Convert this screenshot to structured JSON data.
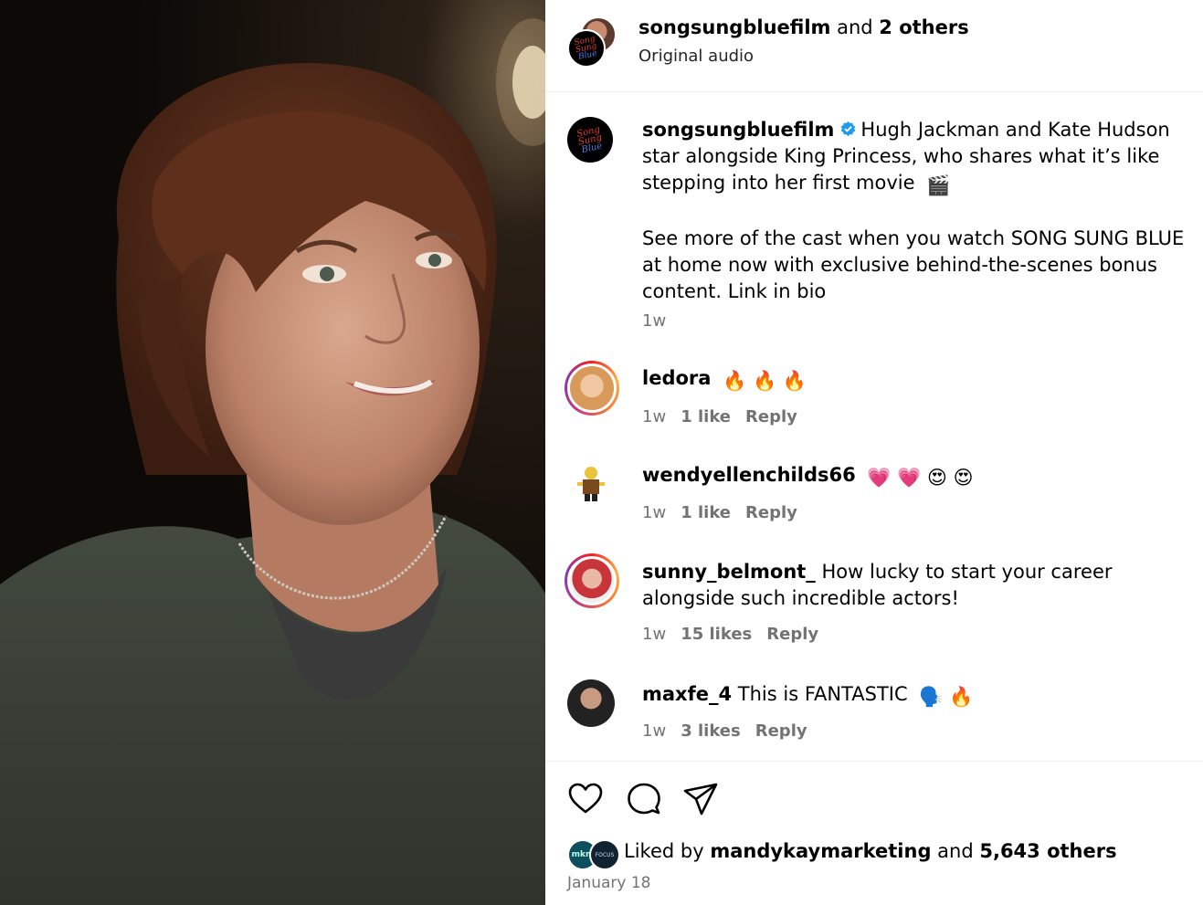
{
  "header": {
    "username": "songsungbluefilm",
    "and_text": " and ",
    "others": "2 others",
    "subtitle": "Original audio"
  },
  "logo": {
    "l1": "Song",
    "l2": "Sung",
    "l3": "Blue"
  },
  "caption": {
    "username": "songsungbluefilm",
    "text1": "Hugh Jackman and Kate Hudson star alongside King Princess, who shares what it’s like stepping into her first movie",
    "emoji1": "🎬",
    "text2": "See more of the cast when you watch SONG SUNG BLUE at home now with exclusive behind-the-scenes bonus content. Link in bio",
    "time": "1w"
  },
  "comments": [
    {
      "username": "ledora",
      "text": "",
      "emojis": "🔥 🔥 🔥",
      "time": "1w",
      "likes": "1 like",
      "reply": "Reply"
    },
    {
      "username": "wendyellenchilds66",
      "text": "",
      "emojis": "💗 💗 😍 😍",
      "time": "1w",
      "likes": "1 like",
      "reply": "Reply"
    },
    {
      "username": "sunny_belmont_",
      "text": "How lucky to start your career alongside such incredible actors!",
      "emojis": "",
      "time": "1w",
      "likes": "15 likes",
      "reply": "Reply"
    },
    {
      "username": "maxfe_4",
      "text": "This is FANTASTIC",
      "emojis": "🗣️ 🔥",
      "time": "1w",
      "likes": "3 likes",
      "reply": "Reply"
    }
  ],
  "liked": {
    "prefix": "Liked by ",
    "user": "mandykaymarketing",
    "and_text": " and ",
    "others": "5,643 others",
    "av1": "mkm",
    "av2": "FOCUS"
  },
  "date": "January 18",
  "icons": {
    "like": "heart-icon",
    "comment": "comment-icon",
    "share": "share-icon",
    "verified": "verified-icon"
  }
}
